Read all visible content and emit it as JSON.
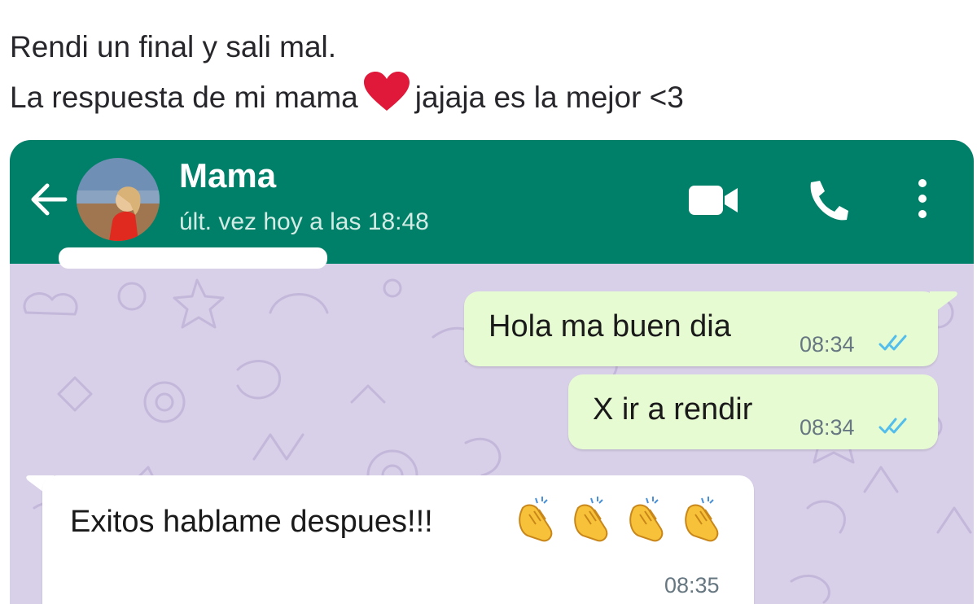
{
  "post": {
    "line1": "Rendi un final y sali mal.",
    "line2_before": "La respuesta de mi mama",
    "line2_after": "jajaja es la mejor <3"
  },
  "header": {
    "contact_name": "Mama",
    "last_seen": "últ. vez hoy a las 18:48",
    "icons": [
      "back-arrow-icon",
      "video-call-icon",
      "phone-icon",
      "more-options-icon"
    ]
  },
  "messages": [
    {
      "direction": "outgoing",
      "text": "Hola ma buen dia",
      "time": "08:34",
      "status": "read"
    },
    {
      "direction": "outgoing",
      "text": "X ir a rendir",
      "time": "08:34",
      "status": "read"
    },
    {
      "direction": "incoming",
      "text": "Exitos hablame despues!!!",
      "emoji": "clapping-hands x4",
      "time": "08:35"
    }
  ],
  "colors": {
    "header_green": "#008069",
    "chat_background": "#d8cfe8",
    "outgoing_bubble": "#e7fbd3",
    "incoming_bubble": "#ffffff",
    "read_ticks": "#53bdeb",
    "heart": "#e0193a"
  }
}
